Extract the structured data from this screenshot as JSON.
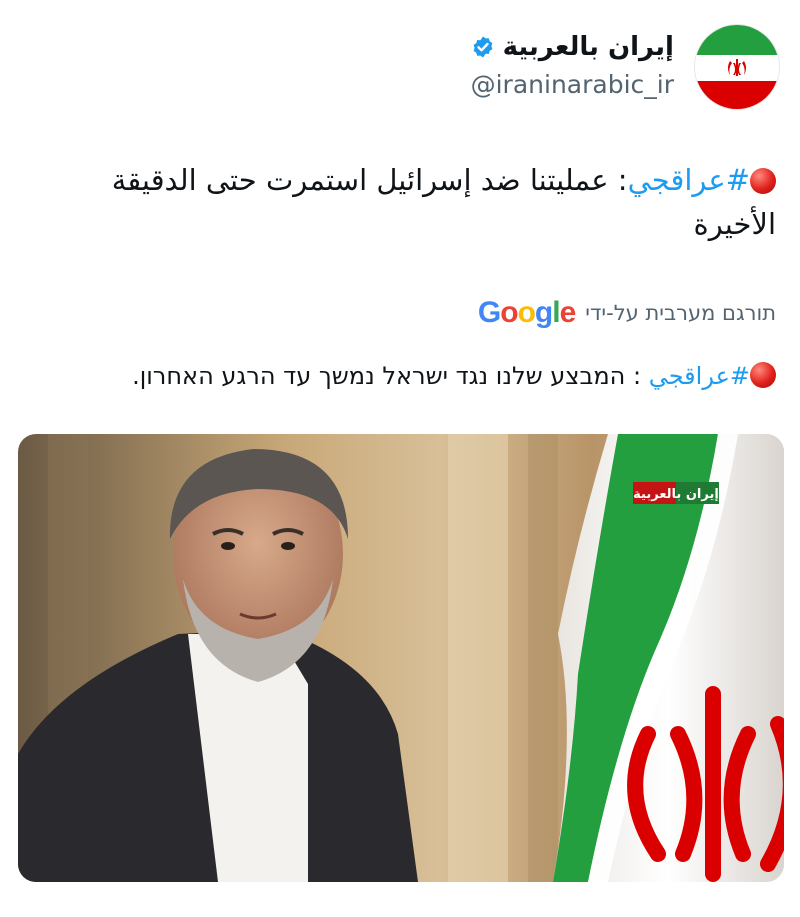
{
  "account": {
    "display_name": "إيران بالعربية",
    "handle": "@iraninarabic_ir",
    "verified": true
  },
  "tweet": {
    "hashtag": "#عراقجي",
    "text": ": عمليتنا ضد إسرائيل استمرت حتى الدقيقة الأخيرة"
  },
  "translation": {
    "label": "תורגם מערבית על-ידי",
    "provider": "Google",
    "hashtag": "#عراقجي",
    "text": " : המבצע שלנו נגד ישראל נמשך עד הרגע האחרון."
  },
  "media": {
    "watermark": "إيران بالعربية"
  },
  "colors": {
    "hashtag": "#1d9bf0",
    "verified": "#1d9bf0",
    "flag_green": "#239f40",
    "flag_red": "#da0000"
  },
  "icons": {
    "verified": "verified-badge-icon",
    "status_dot": "red-circle-icon"
  }
}
